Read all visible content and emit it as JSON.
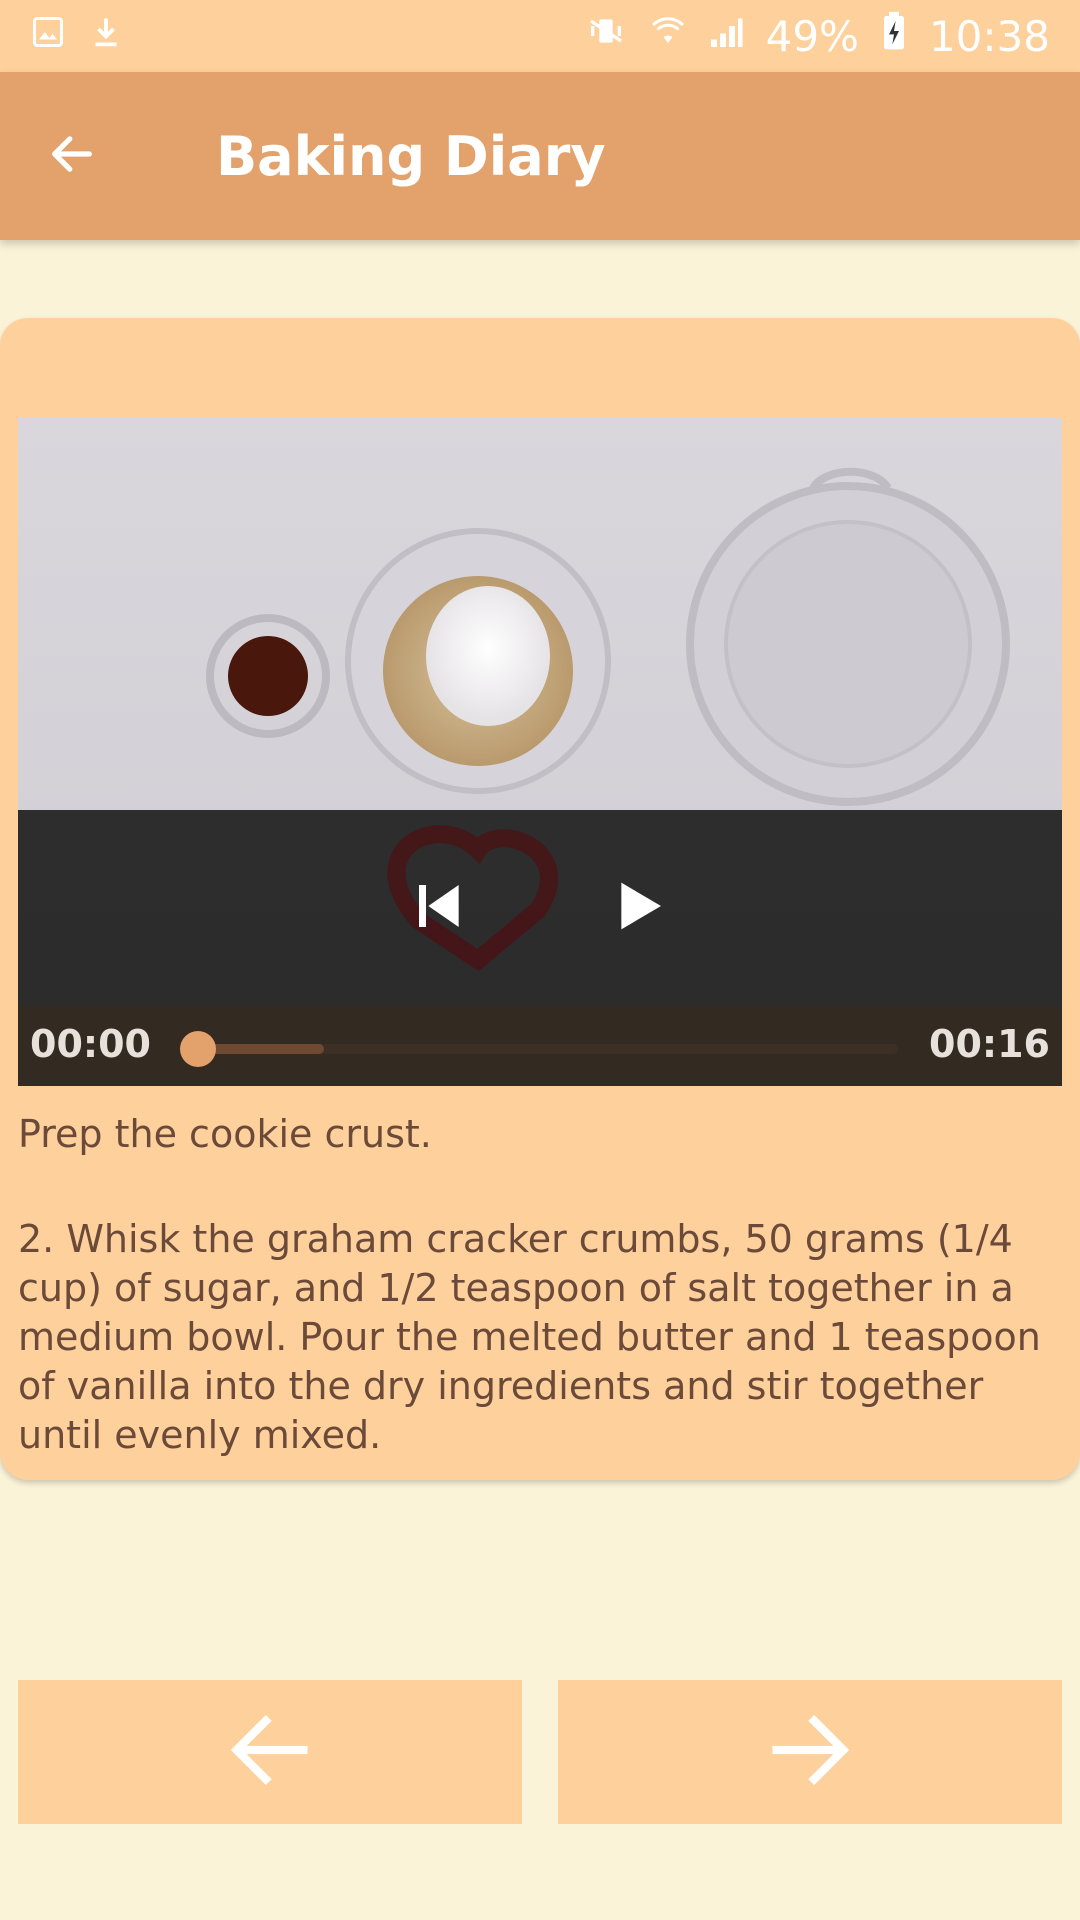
{
  "status_bar": {
    "battery": "49%",
    "time": "10:38"
  },
  "app_bar": {
    "title": "Baking Diary"
  },
  "player": {
    "position": "00:00",
    "duration": "00:16",
    "progress_fraction": 0.0,
    "buffered_fraction": 0.18
  },
  "step": {
    "short_description": "Prep the cookie crust.",
    "description": "2. Whisk the graham cracker crumbs, 50 grams (1/4 cup) of sugar, and 1/2 teaspoon of salt together in a medium bowl. Pour the melted butter and 1 teaspoon of vanilla into the dry ingredients and stir together until evenly mixed."
  },
  "colors": {
    "app_bar": "#e3a26b",
    "status_bar": "#fdd09c",
    "card": "#fdd09c",
    "background": "#faf3d8",
    "text": "#6b4a3a"
  }
}
